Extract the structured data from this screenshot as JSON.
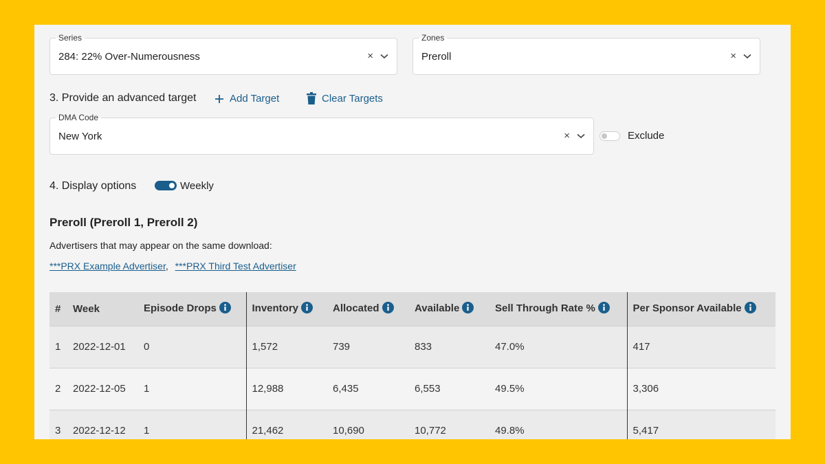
{
  "series": {
    "legend": "Series",
    "value": "284: 22% Over-Numerousness"
  },
  "zones": {
    "legend": "Zones",
    "value": "Preroll"
  },
  "advanced_target": {
    "label": "3. Provide an advanced target",
    "add_label": "Add Target",
    "clear_label": "Clear Targets"
  },
  "dma": {
    "legend": "DMA Code",
    "value": "New York",
    "exclude_label": "Exclude",
    "exclude_on": false
  },
  "display_options": {
    "label": "4. Display options",
    "weekly_label": "Weekly",
    "weekly_on": true
  },
  "zone_heading": "Preroll (Preroll 1, Preroll 2)",
  "advertisers": {
    "intro": "Advertisers that may appear on the same download:",
    "links": [
      "***PRX Example Advertiser",
      "***PRX Third Test Advertiser"
    ],
    "separator": ","
  },
  "table": {
    "headers": [
      "#",
      "Week",
      "Episode Drops",
      "Inventory",
      "Allocated",
      "Available",
      "Sell Through Rate %",
      "Per Sponsor Available"
    ],
    "rows": [
      [
        "1",
        "2022-12-01",
        "0",
        "1,572",
        "739",
        "833",
        "47.0%",
        "417"
      ],
      [
        "2",
        "2022-12-05",
        "1",
        "12,988",
        "6,435",
        "6,553",
        "49.5%",
        "3,306"
      ],
      [
        "3",
        "2022-12-12",
        "1",
        "21,462",
        "10,690",
        "10,772",
        "49.8%",
        "5,417"
      ]
    ]
  },
  "colors": {
    "background": "#FFC500",
    "panel": "#F4F4F4",
    "accent": "#1A5E8C"
  },
  "icons": {
    "clear": "close-icon",
    "dropdown": "chevron-down-icon",
    "add": "plus-icon",
    "trash": "trash-icon",
    "info": "info-icon"
  }
}
